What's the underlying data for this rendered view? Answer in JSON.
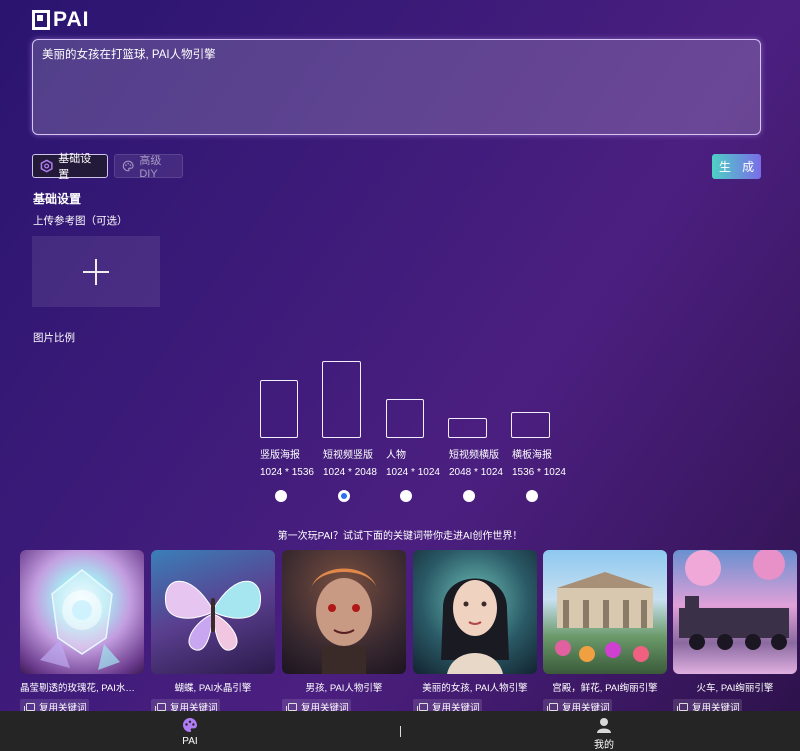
{
  "app": {
    "logo_text": "PAI"
  },
  "prompt": {
    "value": "美丽的女孩在打篮球, PAI人物引擎"
  },
  "modes": {
    "basic_label": "基础设置",
    "diy_label": "高级DIY"
  },
  "generate_label": "生 成",
  "settings": {
    "title": "基础设置",
    "upload_label": "上传参考图（可选）",
    "ratio_label": "图片比例"
  },
  "ratios": [
    {
      "name": "竖版海报",
      "size": "1024 * 1536",
      "selected": false
    },
    {
      "name": "短视频竖版",
      "size": "1024 * 2048",
      "selected": true
    },
    {
      "name": "人物",
      "size": "1024 * 1024",
      "selected": false
    },
    {
      "name": "短视频横版",
      "size": "2048 * 1024",
      "selected": false
    },
    {
      "name": "横板海报",
      "size": "1536 * 1024",
      "selected": false
    }
  ],
  "intro_text": "第一次玩PAI？试试下面的关键词带你走进AI创作世界！",
  "gallery": [
    {
      "caption": "晶莹剔透的玫瑰花, PAI水晶引擎",
      "copy_label": "复用关键词"
    },
    {
      "caption": "蝴蝶, PAI水晶引擎",
      "copy_label": "复用关键词"
    },
    {
      "caption": "男孩, PAI人物引擎",
      "copy_label": "复用关键词"
    },
    {
      "caption": "美丽的女孩, PAI人物引擎",
      "copy_label": "复用关键词"
    },
    {
      "caption": "宫殿，鲜花, PAI绚丽引擎",
      "copy_label": "复用关键词"
    },
    {
      "caption": "火车, PAI绚丽引擎",
      "copy_label": "复用关键词"
    }
  ],
  "nav": {
    "home_label": "PAI",
    "mine_label": "我的"
  },
  "colors": {
    "accent_start": "#4ed0c6",
    "accent_end": "#7a6de8",
    "radio_selected": "#2f6df0"
  }
}
